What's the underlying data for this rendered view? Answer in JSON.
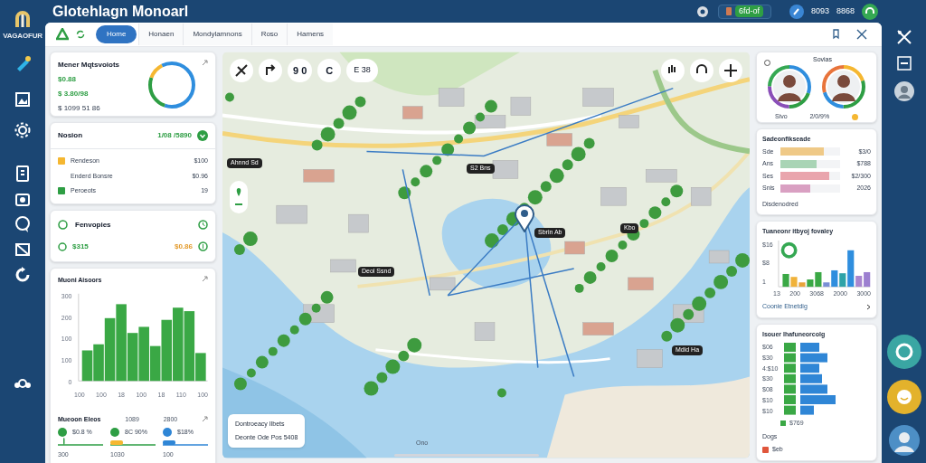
{
  "app": {
    "logo_text": "VAGAOFUR",
    "title": "Glotehlagn Monoarl"
  },
  "header": {
    "chip": "6fd-of",
    "stat_1": "8093",
    "stat_2": "8868"
  },
  "toolbar": {
    "tabs": [
      {
        "label": "Home",
        "selected": true
      },
      {
        "label": "Honaen",
        "selected": false
      },
      {
        "label": "Mondylamnons",
        "selected": false
      },
      {
        "label": "Roso",
        "selected": false
      },
      {
        "label": "Hamens",
        "selected": false
      }
    ]
  },
  "summary_card": {
    "title": "Mener Mqtsvoiots",
    "lines": [
      "$0.88",
      "$ 3.80/98",
      "$ 1099 51 86"
    ]
  },
  "session_card": {
    "title": "Nosion",
    "values": "1/08 /5890",
    "rows": [
      {
        "label": "Rendeson",
        "value": "$100",
        "color": "#f5b731"
      },
      {
        "label": "Enderd Bonsre",
        "value": "$0.96",
        "color": null
      },
      {
        "label": "Peroeots",
        "value": "19",
        "color": "#2e9e44"
      }
    ]
  },
  "finance_card": {
    "title": "Fenvopies",
    "value_1": "$315",
    "value_2": "$0.86"
  },
  "bar_card": {
    "title": "Muoni Aisoors",
    "yticks": [
      "300",
      "200",
      "100",
      "100",
      "0"
    ],
    "xlabels": [
      "100",
      "100",
      "18",
      "100",
      "18",
      "110",
      "100"
    ],
    "sub_title": "Mueoon Eleos",
    "sub_value_1": "1089",
    "sub_value_2": "2800",
    "points": [
      {
        "reading": "$0.8 %",
        "label": "300",
        "color": "#2e9e44"
      },
      {
        "reading": "8C 90%",
        "label": "1030",
        "color": "#2e9e44"
      },
      {
        "reading": "$18%",
        "label": "100",
        "color": "#2f86d6"
      }
    ]
  },
  "map": {
    "top_controls": [
      "9 0",
      "C"
    ],
    "chip": "E 38",
    "labels": [
      "Ahnnd Sd",
      "S2 Bns",
      "Deol Ssnd",
      "Sbrin Ab",
      "Mdid Ha",
      "Kbo"
    ],
    "legend": [
      "Dontroeacy Ilbets",
      "Deonte Ode Pos 5408"
    ],
    "bottom_label": "Ono"
  },
  "people_card": {
    "title": "Sovias",
    "caption_1": "Sivo",
    "caption_2": "2/0/9%"
  },
  "progress_card": {
    "title": "Sadeonfikseade",
    "rows": [
      {
        "label": "Sde",
        "value": "$3/0",
        "level": 0.72,
        "color": "#efc987"
      },
      {
        "label": "Ans",
        "value": "$788",
        "level": 0.6,
        "color": "#a9d4b5"
      },
      {
        "label": "Ses",
        "value": "$2/300",
        "level": 0.82,
        "color": "#e9a5ad"
      },
      {
        "label": "Snis",
        "value": "2026",
        "level": 0.5,
        "color": "#d9a0c2"
      }
    ],
    "footer": "Disdenodred"
  },
  "column_card": {
    "title": "Tuaneonr itbyoj fovaley",
    "yticks": [
      "$16",
      "$8",
      "1"
    ],
    "xlabels": [
      "13",
      "200",
      "3068",
      "2000",
      "3000"
    ],
    "footer": "Coonie Etnetdig"
  },
  "hbar_card": {
    "title": "Isouer Ihafuneorcolg",
    "ylabels": [
      "$06",
      "$30",
      "4:$10",
      "$30",
      "$08",
      "$10",
      "$10"
    ],
    "legend": "$769",
    "sub_title": "Dogs",
    "sub_value": "$eb"
  }
}
